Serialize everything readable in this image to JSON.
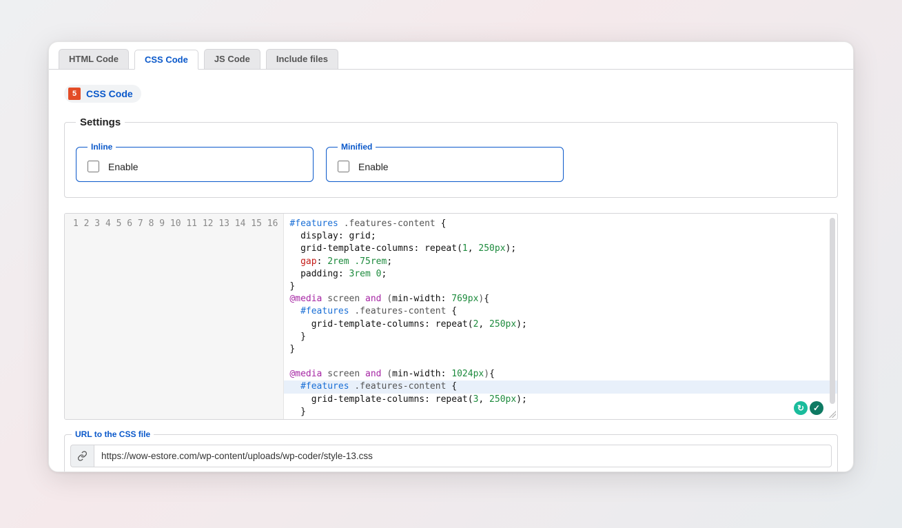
{
  "tabs": [
    {
      "label": "HTML Code"
    },
    {
      "label": "CSS Code"
    },
    {
      "label": "JS Code"
    },
    {
      "label": "Include files"
    }
  ],
  "active_tab_index": 1,
  "chip": {
    "icon_glyph": "5",
    "label": "CSS Code"
  },
  "settings": {
    "legend": "Settings",
    "inline": {
      "legend": "Inline",
      "enable_label": "Enable",
      "checked": false
    },
    "minified": {
      "legend": "Minified",
      "enable_label": "Enable",
      "checked": false
    }
  },
  "editor": {
    "line_count": 16,
    "highlighted_line": 14,
    "code_tokens": [
      [
        [
          "id",
          "#features"
        ],
        [
          "sel",
          " .features-content "
        ],
        [
          "punc",
          "{"
        ]
      ],
      [
        [
          "sel",
          "  "
        ],
        [
          "prop",
          "display"
        ],
        [
          "punc",
          ": "
        ],
        [
          "prop",
          "grid"
        ],
        [
          "punc",
          ";"
        ]
      ],
      [
        [
          "sel",
          "  "
        ],
        [
          "prop",
          "grid-template-columns"
        ],
        [
          "punc",
          ": "
        ],
        [
          "fn",
          "repeat"
        ],
        [
          "punc",
          "("
        ],
        [
          "num",
          "1"
        ],
        [
          "punc",
          ", "
        ],
        [
          "num",
          "250"
        ],
        [
          "unit",
          "px"
        ],
        [
          "punc",
          ");"
        ]
      ],
      [
        [
          "sel",
          "  "
        ],
        [
          "kw",
          "gap"
        ],
        [
          "punc",
          ": "
        ],
        [
          "num",
          "2"
        ],
        [
          "unit",
          "rem "
        ],
        [
          "num",
          ".75"
        ],
        [
          "unit",
          "rem"
        ],
        [
          "punc",
          ";"
        ]
      ],
      [
        [
          "sel",
          "  "
        ],
        [
          "prop",
          "padding"
        ],
        [
          "punc",
          ": "
        ],
        [
          "num",
          "3"
        ],
        [
          "unit",
          "rem "
        ],
        [
          "num",
          "0"
        ],
        [
          "punc",
          ";"
        ]
      ],
      [
        [
          "punc",
          "}"
        ]
      ],
      [
        [
          "kw2",
          "@media"
        ],
        [
          "sel",
          " screen "
        ],
        [
          "and",
          "and"
        ],
        [
          "sel",
          " ("
        ],
        [
          "prop",
          "min-width"
        ],
        [
          "punc",
          ": "
        ],
        [
          "num",
          "769"
        ],
        [
          "unit",
          "px"
        ],
        [
          "sel",
          ")"
        ],
        [
          "punc",
          "{"
        ]
      ],
      [
        [
          "sel",
          "  "
        ],
        [
          "id",
          "#features"
        ],
        [
          "sel",
          " .features-content "
        ],
        [
          "punc",
          "{"
        ]
      ],
      [
        [
          "sel",
          "    "
        ],
        [
          "prop",
          "grid-template-columns"
        ],
        [
          "punc",
          ": "
        ],
        [
          "fn",
          "repeat"
        ],
        [
          "punc",
          "("
        ],
        [
          "num",
          "2"
        ],
        [
          "punc",
          ", "
        ],
        [
          "num",
          "250"
        ],
        [
          "unit",
          "px"
        ],
        [
          "punc",
          ");"
        ]
      ],
      [
        [
          "sel",
          "  "
        ],
        [
          "punc",
          "}"
        ]
      ],
      [
        [
          "punc",
          "}"
        ]
      ],
      [],
      [
        [
          "kw2",
          "@media"
        ],
        [
          "sel",
          " screen "
        ],
        [
          "and",
          "and"
        ],
        [
          "sel",
          " ("
        ],
        [
          "prop",
          "min-width"
        ],
        [
          "punc",
          ": "
        ],
        [
          "num",
          "1024"
        ],
        [
          "unit",
          "px"
        ],
        [
          "sel",
          ")"
        ],
        [
          "punc",
          "{"
        ]
      ],
      [
        [
          "sel",
          "  "
        ],
        [
          "id",
          "#features"
        ],
        [
          "sel",
          " .features-content "
        ],
        [
          "punc",
          "{"
        ]
      ],
      [
        [
          "sel",
          "    "
        ],
        [
          "prop",
          "grid-template-columns"
        ],
        [
          "punc",
          ": "
        ],
        [
          "fn",
          "repeat"
        ],
        [
          "punc",
          "("
        ],
        [
          "num",
          "3"
        ],
        [
          "punc",
          ", "
        ],
        [
          "num",
          "250"
        ],
        [
          "unit",
          "px"
        ],
        [
          "punc",
          ");"
        ]
      ],
      [
        [
          "sel",
          "  "
        ],
        [
          "punc",
          "}"
        ]
      ]
    ]
  },
  "url_field": {
    "legend": "URL to the CSS file",
    "value": "https://wow-estore.com/wp-content/uploads/wp-coder/style-13.css"
  }
}
